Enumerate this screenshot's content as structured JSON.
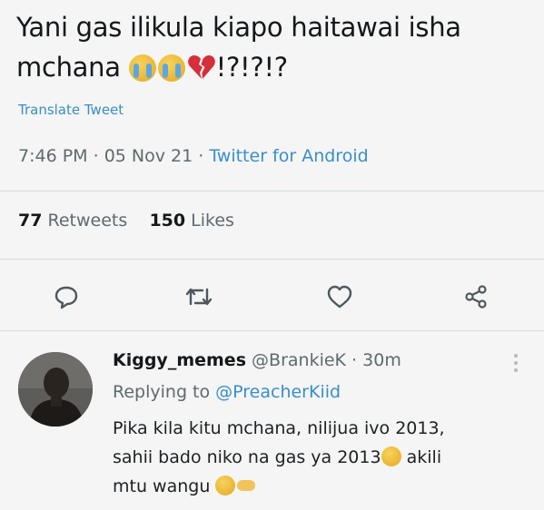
{
  "tweet": {
    "text_line1": "Yani gas ilikula kiapo haitawai isha",
    "text_line2_start": "mchana ",
    "text_line2_end": "!?!?!?",
    "emojis": [
      "loudly-crying-face",
      "loudly-crying-face",
      "broken-heart"
    ],
    "translate_label": "Translate Tweet",
    "time": "7:46 PM",
    "date": "05 Nov 21",
    "client": "Twitter for Android",
    "sep": " · "
  },
  "stats": {
    "retweets_count": "77",
    "retweets_label": "Retweets",
    "likes_count": "150",
    "likes_label": "Likes"
  },
  "actions": {
    "icons": [
      "reply-icon",
      "retweet-icon",
      "like-icon",
      "share-icon"
    ]
  },
  "reply": {
    "display_name": "Kiggy_memes",
    "handle": "@BrankieK",
    "time_ago": "30m",
    "sep": " · ",
    "replying_prefix": "Replying to ",
    "replying_handle": "@PreacherKiid",
    "line1": "Pika kila kitu mchana, nilijua ivo 2013,",
    "line2_start": "sahii bado niko na gas ya 2013",
    "line2_end": " akili",
    "line3": "mtu wangu",
    "emojis": [
      "grinning-squinting-face",
      "joy-face",
      "backhand-index-pointing-left"
    ]
  },
  "colors": {
    "background": "#f4f5f4",
    "link_blue": "#3b8ec9",
    "muted_gray": "#5f6970"
  }
}
